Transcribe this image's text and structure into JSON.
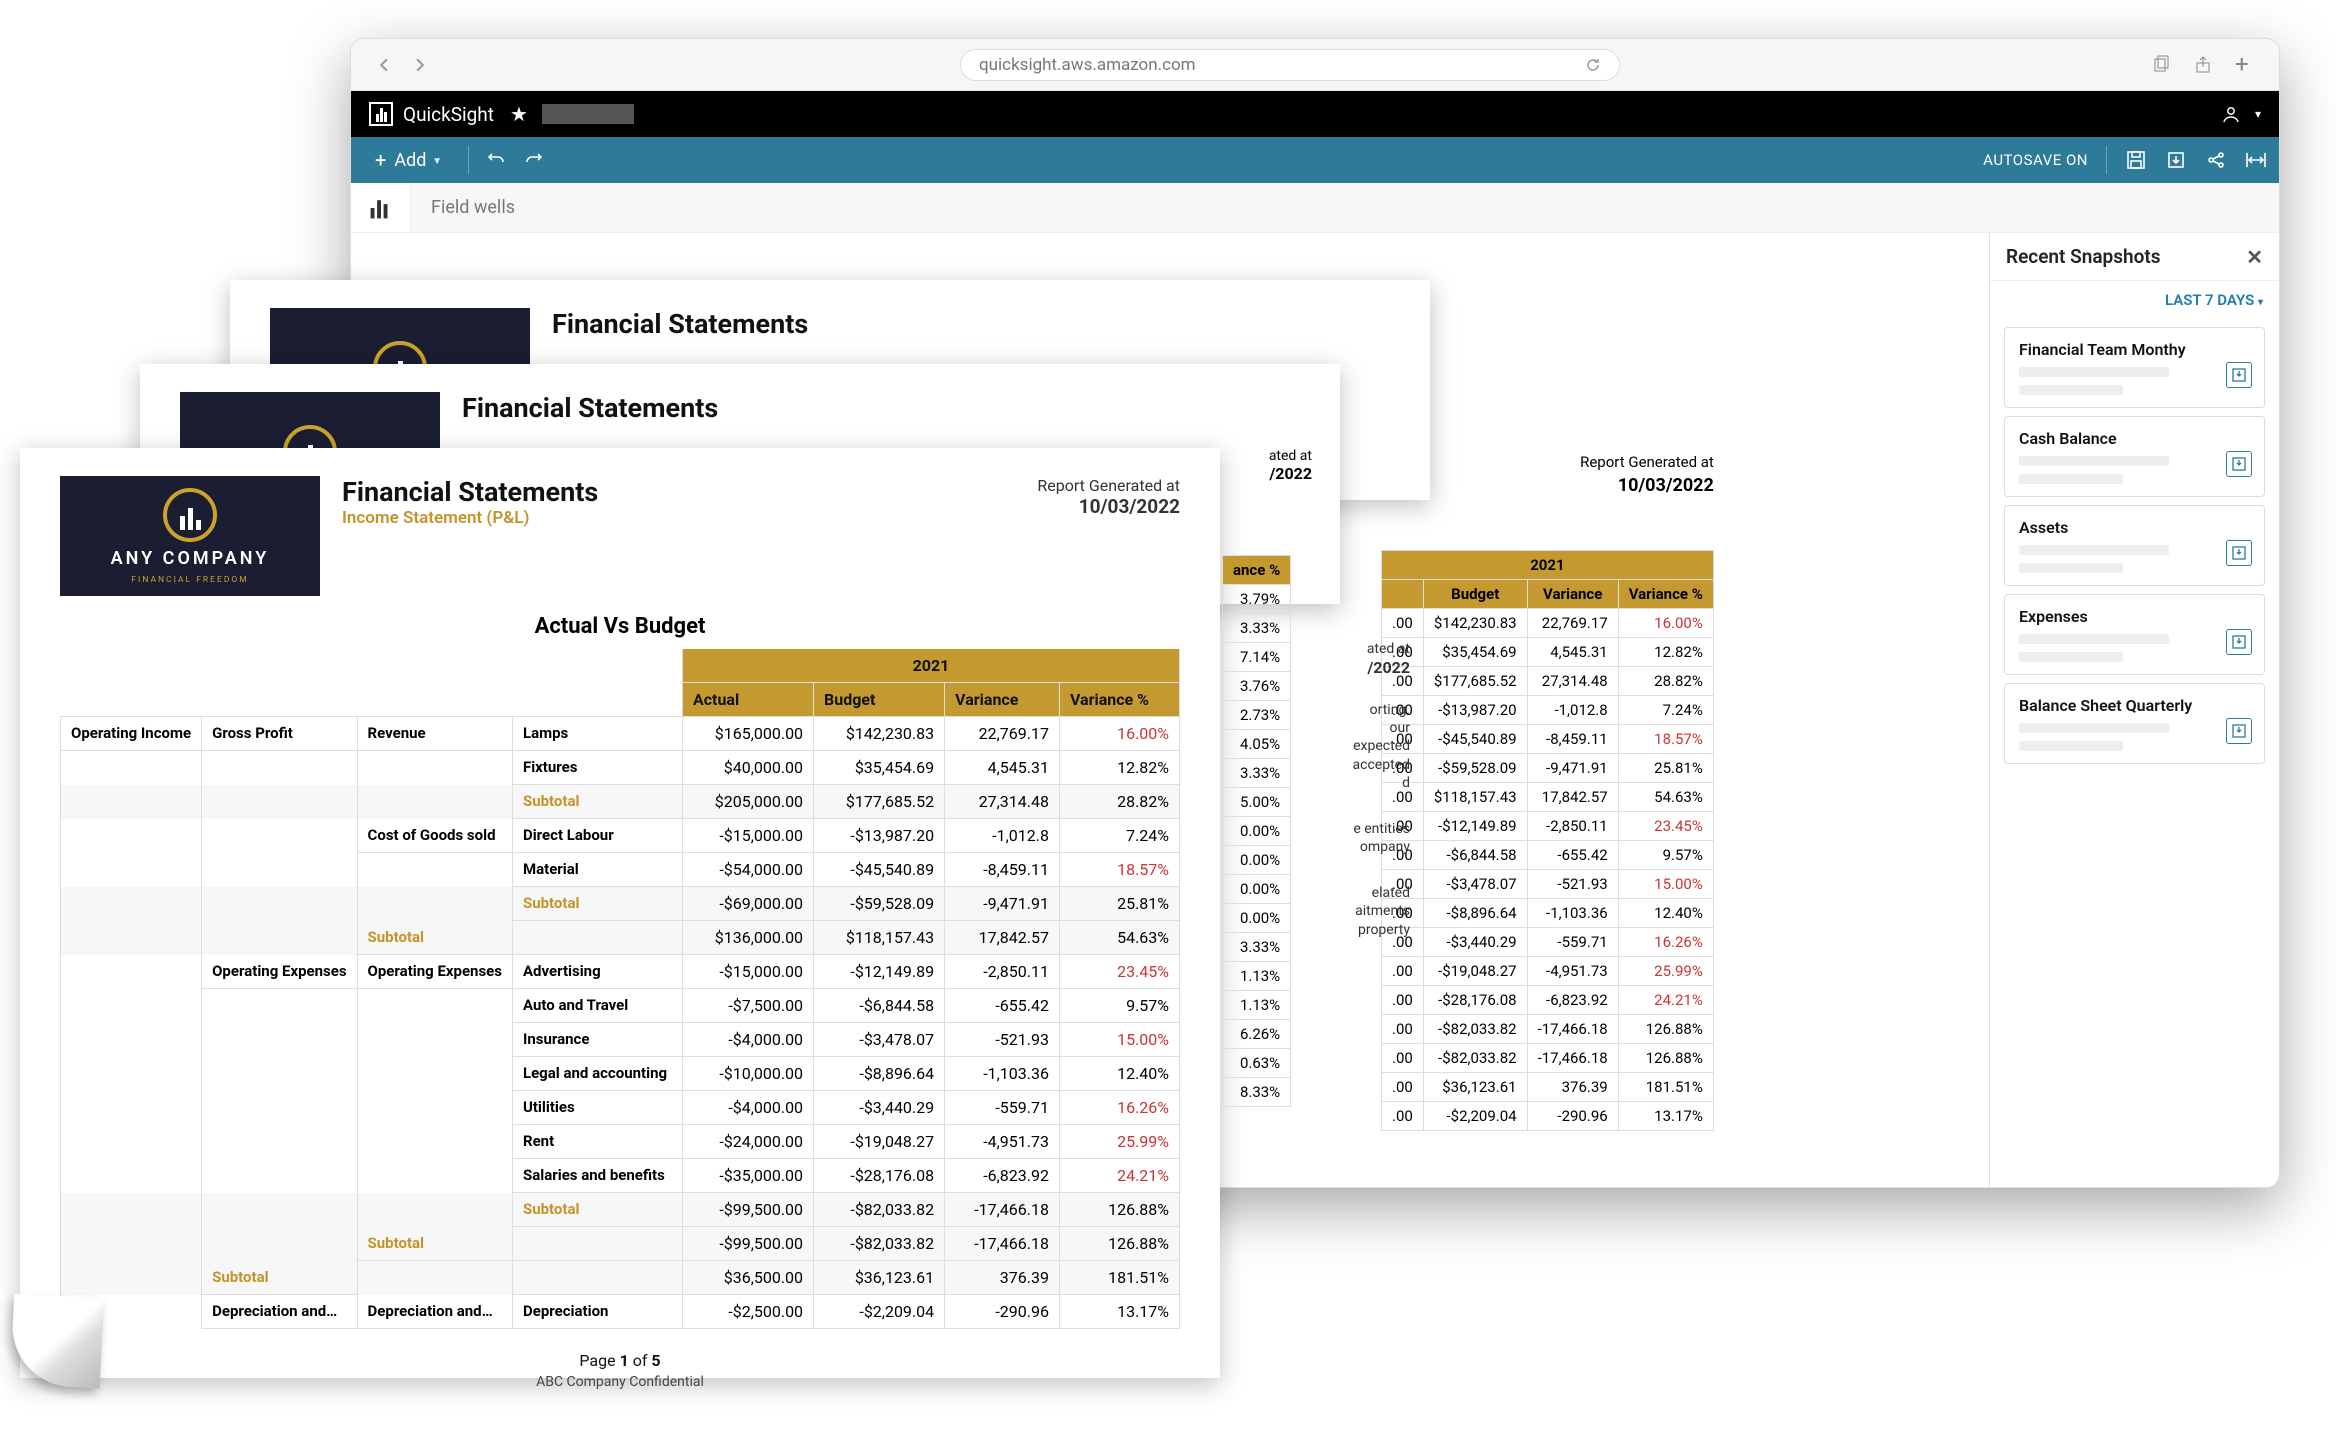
{
  "chrome": {
    "url": "quicksight.aws.amazon.com"
  },
  "quicksight": {
    "brand": "QuickSight"
  },
  "toolbar": {
    "add_label": "Add",
    "autosave_label": "AUTOSAVE ON"
  },
  "field_wells": {
    "label": "Field wells"
  },
  "snapshots": {
    "header": "Recent Snapshots",
    "filter_label": "LAST 7 DAYS",
    "items": [
      {
        "title": "Financial Team Monthy"
      },
      {
        "title": "Cash Balance"
      },
      {
        "title": "Assets"
      },
      {
        "title": "Expenses"
      },
      {
        "title": "Balance Sheet Quarterly"
      }
    ]
  },
  "report": {
    "company_name": "ANY COMPANY",
    "company_tagline": "FINANCIAL FREEDOM",
    "title": "Financial Statements",
    "subtitle": "Income Statement  (P&L)",
    "generated_label": "Report Generated at",
    "generated_date": "10/03/2022",
    "section": "Actual Vs Budget",
    "year": "2021",
    "columns": [
      "Actual",
      "Budget",
      "Variance",
      "Variance %"
    ],
    "footer_page": "Page 1 of 5",
    "footer_confidential": "ABC Company Confidential",
    "rows": [
      {
        "g1": "Operating Income",
        "g2": "Gross Profit",
        "g3": "Revenue",
        "label": "Lamps",
        "actual": "$165,000.00",
        "budget": "$142,230.83",
        "variance": "22,769.17",
        "variance_pct": "16.00%",
        "neg_pct": true
      },
      {
        "g1": "",
        "g2": "",
        "g3": "",
        "label": "Fixtures",
        "actual": "$40,000.00",
        "budget": "$35,454.69",
        "variance": "4,545.31",
        "variance_pct": "12.82%"
      },
      {
        "g1": "",
        "g2": "",
        "g3": "",
        "label": "Subtotal",
        "sub": true,
        "actual": "$205,000.00",
        "budget": "$177,685.52",
        "variance": "27,314.48",
        "variance_pct": "28.82%",
        "alt": true
      },
      {
        "g1": "",
        "g2": "",
        "g3": "Cost of Goods sold",
        "label": "Direct Labour",
        "actual": "-$15,000.00",
        "budget": "-$13,987.20",
        "variance": "-1,012.8",
        "variance_pct": "7.24%"
      },
      {
        "g1": "",
        "g2": "",
        "g3": "",
        "label": "Material",
        "actual": "-$54,000.00",
        "budget": "-$45,540.89",
        "variance": "-8,459.11",
        "variance_pct": "18.57%",
        "neg_pct": true
      },
      {
        "g1": "",
        "g2": "",
        "g3": "",
        "label": "Subtotal",
        "sub": true,
        "actual": "-$69,000.00",
        "budget": "-$59,528.09",
        "variance": "-9,471.91",
        "variance_pct": "25.81%",
        "alt": true
      },
      {
        "g1": "",
        "g2": "",
        "g3": "Subtotal",
        "sub3": true,
        "label": "",
        "actual": "$136,000.00",
        "budget": "$118,157.43",
        "variance": "17,842.57",
        "variance_pct": "54.63%",
        "alt": true
      },
      {
        "g1": "",
        "g2": "Operating Expenses",
        "g3": "Operating Expenses",
        "label": "Advertising",
        "actual": "-$15,000.00",
        "budget": "-$12,149.89",
        "variance": "-2,850.11",
        "variance_pct": "23.45%",
        "neg_pct": true
      },
      {
        "g1": "",
        "g2": "",
        "g3": "",
        "label": "Auto and Travel",
        "actual": "-$7,500.00",
        "budget": "-$6,844.58",
        "variance": "-655.42",
        "variance_pct": "9.57%"
      },
      {
        "g1": "",
        "g2": "",
        "g3": "",
        "label": "Insurance",
        "actual": "-$4,000.00",
        "budget": "-$3,478.07",
        "variance": "-521.93",
        "variance_pct": "15.00%",
        "neg_pct": true
      },
      {
        "g1": "",
        "g2": "",
        "g3": "",
        "label": "Legal and accounting",
        "actual": "-$10,000.00",
        "budget": "-$8,896.64",
        "variance": "-1,103.36",
        "variance_pct": "12.40%"
      },
      {
        "g1": "",
        "g2": "",
        "g3": "",
        "label": "Utilities",
        "actual": "-$4,000.00",
        "budget": "-$3,440.29",
        "variance": "-559.71",
        "variance_pct": "16.26%",
        "neg_pct": true
      },
      {
        "g1": "",
        "g2": "",
        "g3": "",
        "label": "Rent",
        "actual": "-$24,000.00",
        "budget": "-$19,048.27",
        "variance": "-4,951.73",
        "variance_pct": "25.99%",
        "neg_pct": true
      },
      {
        "g1": "",
        "g2": "",
        "g3": "",
        "label": "Salaries and benefits",
        "actual": "-$35,000.00",
        "budget": "-$28,176.08",
        "variance": "-6,823.92",
        "variance_pct": "24.21%",
        "neg_pct": true
      },
      {
        "g1": "",
        "g2": "",
        "g3": "",
        "label": "Subtotal",
        "sub": true,
        "actual": "-$99,500.00",
        "budget": "-$82,033.82",
        "variance": "-17,466.18",
        "variance_pct": "126.88%",
        "alt": true
      },
      {
        "g1": "",
        "g2": "",
        "g3": "Subtotal",
        "sub3": true,
        "label": "",
        "actual": "-$99,500.00",
        "budget": "-$82,033.82",
        "variance": "-17,466.18",
        "variance_pct": "126.88%",
        "alt": true
      },
      {
        "g1": "",
        "g2": "Subtotal",
        "sub2": true,
        "g3": "",
        "label": "",
        "actual": "$36,500.00",
        "budget": "$36,123.61",
        "variance": "376.39",
        "variance_pct": "181.51%",
        "alt": true
      },
      {
        "g1": "",
        "g2": "Depreciation and…",
        "g3": "Depreciation and…",
        "label": "Depreciation",
        "actual": "-$2,500.00",
        "budget": "-$2,209.04",
        "variance": "-290.96",
        "variance_pct": "13.17%"
      }
    ]
  },
  "peek_right": {
    "generated_label": "Report Generated at",
    "date": "10/03/2022",
    "year": "2021",
    "cols": [
      "Budget",
      "Variance",
      "Variance %"
    ],
    "rows": [
      {
        "a": ".00",
        "b": "$142,230.83",
        "c": "22,769.17",
        "d": "16.00%",
        "neg": true
      },
      {
        "a": ".00",
        "b": "$35,454.69",
        "c": "4,545.31",
        "d": "12.82%"
      },
      {
        "a": ".00",
        "b": "$177,685.52",
        "c": "27,314.48",
        "d": "28.82%"
      },
      {
        "a": ".00",
        "b": "-$13,987.20",
        "c": "-1,012.8",
        "d": "7.24%"
      },
      {
        "a": ".00",
        "b": "-$45,540.89",
        "c": "-8,459.11",
        "d": "18.57%",
        "neg": true
      },
      {
        "a": ".00",
        "b": "-$59,528.09",
        "c": "-9,471.91",
        "d": "25.81%"
      },
      {
        "a": ".00",
        "b": "$118,157.43",
        "c": "17,842.57",
        "d": "54.63%"
      },
      {
        "a": ".00",
        "b": "-$12,149.89",
        "c": "-2,850.11",
        "d": "23.45%",
        "neg": true
      },
      {
        "a": ".00",
        "b": "-$6,844.58",
        "c": "-655.42",
        "d": "9.57%"
      },
      {
        "a": ".00",
        "b": "-$3,478.07",
        "c": "-521.93",
        "d": "15.00%",
        "neg": true
      },
      {
        "a": ".00",
        "b": "-$8,896.64",
        "c": "-1,103.36",
        "d": "12.40%"
      },
      {
        "a": ".00",
        "b": "-$3,440.29",
        "c": "-559.71",
        "d": "16.26%",
        "neg": true
      },
      {
        "a": ".00",
        "b": "-$19,048.27",
        "c": "-4,951.73",
        "d": "25.99%",
        "neg": true
      },
      {
        "a": ".00",
        "b": "-$28,176.08",
        "c": "-6,823.92",
        "d": "24.21%",
        "neg": true
      },
      {
        "a": ".00",
        "b": "-$82,033.82",
        "c": "-17,466.18",
        "d": "126.88%"
      },
      {
        "a": ".00",
        "b": "-$82,033.82",
        "c": "-17,466.18",
        "d": "126.88%"
      },
      {
        "a": ".00",
        "b": "$36,123.61",
        "c": "376.39",
        "d": "181.51%"
      },
      {
        "a": ".00",
        "b": "-$2,209.04",
        "c": "-290.96",
        "d": "13.17%"
      }
    ]
  },
  "peek_mid": {
    "dates": [
      "ated at",
      "/2022",
      "ated at",
      "/2022"
    ],
    "col": "ance %",
    "texts": [
      "orting.",
      "our",
      "expected",
      "accepted",
      "d",
      "e entities",
      "ompany",
      "elated",
      "aitments",
      "property"
    ],
    "vals": [
      {
        "v": "3.79%"
      },
      {
        "v": "3.33%"
      },
      {
        "v": "7.14%"
      },
      {
        "v": "3.76%"
      },
      {
        "v": "2.73%"
      },
      {
        "v": "4.05%"
      },
      {
        "v": "3.33%"
      },
      {
        "v": "5.00%"
      },
      {
        "v": "0.00%"
      },
      {
        "v": "0.00%"
      },
      {
        "v": "0.00%"
      },
      {
        "v": "0.00%"
      },
      {
        "v": "3.33%"
      },
      {
        "v": "1.13%"
      },
      {
        "v": "1.13%"
      },
      {
        "v": "6.26%"
      },
      {
        "v": "0.63%"
      },
      {
        "v": "8.33%"
      }
    ]
  }
}
